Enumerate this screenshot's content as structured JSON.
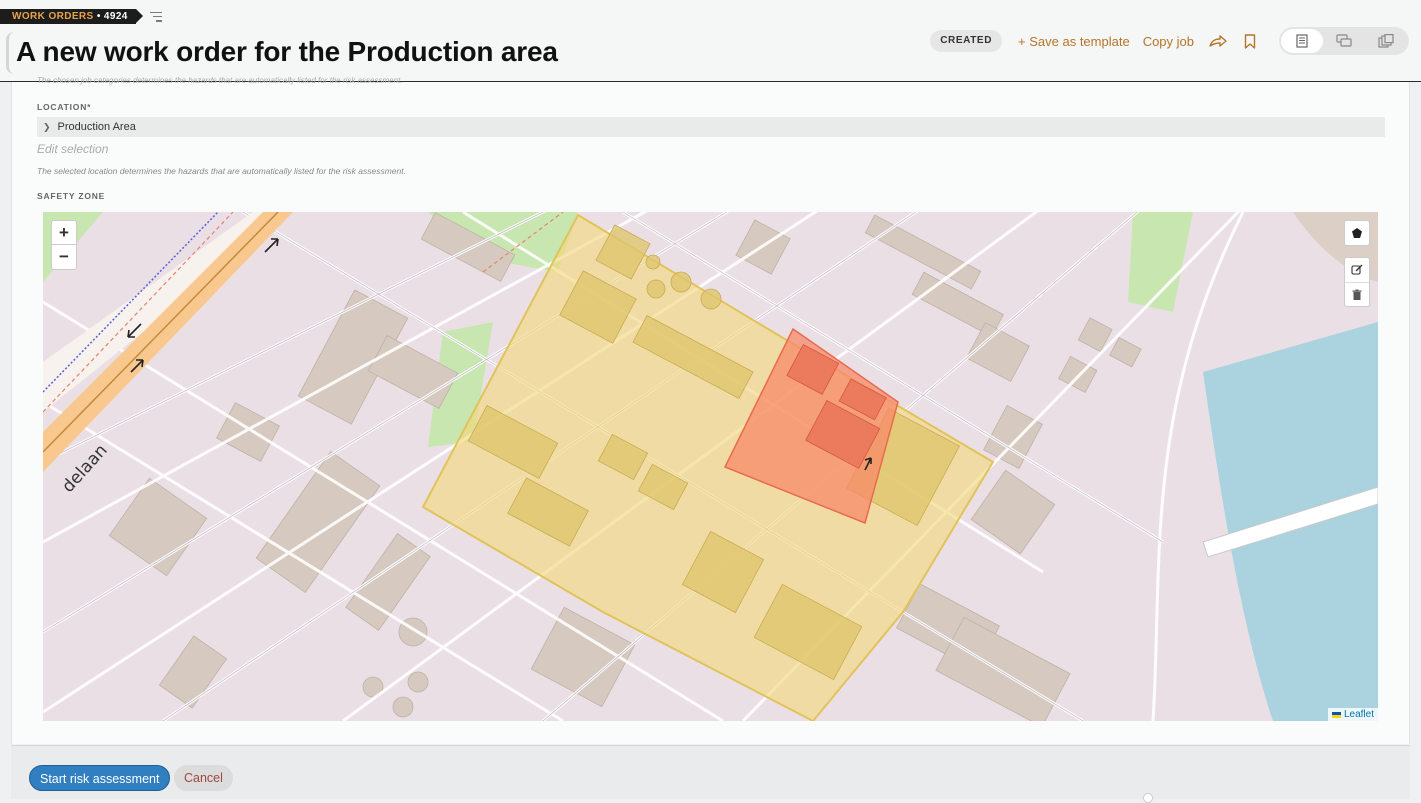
{
  "header": {
    "breadcrumb": {
      "section": "WORK ORDERS",
      "separator": "•",
      "id": "4924"
    },
    "title": "A new work order for the Production area",
    "status": "CREATED",
    "actions": {
      "save_template": "+ Save as template",
      "copy_job": "Copy job"
    },
    "icons": [
      "share-icon",
      "bookmark-icon",
      "document-view-icon",
      "comments-view-icon",
      "gallery-view-icon"
    ]
  },
  "form": {
    "top_hint": "The chosen job categories determines the hazards that are automatically listed for the risk assessment.",
    "location": {
      "label": "LOCATION*",
      "value": "Production Area",
      "edit_label": "Edit selection",
      "hint": "The selected location determines the hazards that are automatically listed for the risk assessment."
    },
    "safety_zone": {
      "label": "SAFETY ZONE",
      "map": {
        "zoom_in": "+",
        "zoom_out": "−",
        "street_label": "delaan",
        "attribution": "Leaflet",
        "colors": {
          "location_area": "#f4d97a",
          "safety_zone": "#f88a6a",
          "water": "#aad3df",
          "park": "#c8e6b0",
          "land": "#ebdfe6",
          "building": "#d6cac0"
        }
      }
    }
  },
  "footer": {
    "start_label": "Start risk assessment",
    "cancel_label": "Cancel"
  }
}
